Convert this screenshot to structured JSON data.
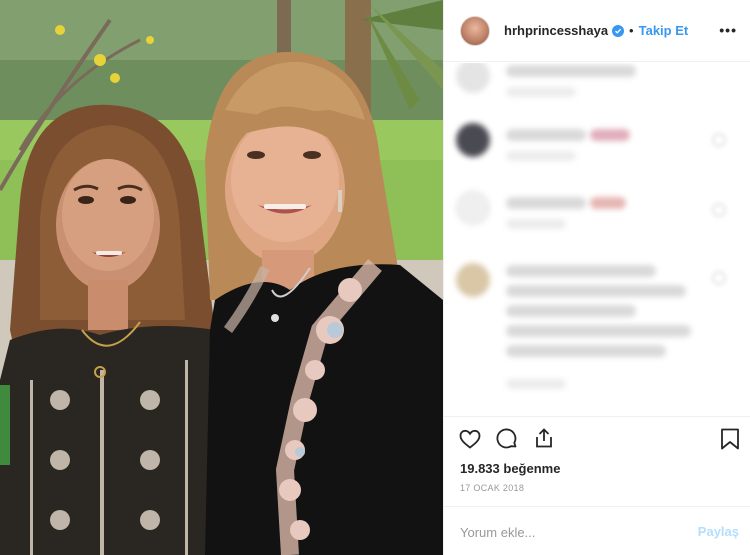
{
  "post": {
    "username": "hrhprincesshaya",
    "follow_label": "Takip Et",
    "separator": "•",
    "more_label": "•••",
    "likes_text": "19.833 beğenme",
    "date_text": "17 OCAK 2018"
  },
  "comment_box": {
    "placeholder": "Yorum ekle...",
    "share_label": "Paylaş"
  },
  "colors": {
    "accent": "#3897f0",
    "share_disabled": "#b2dffc",
    "text": "#262626",
    "muted": "#999999"
  },
  "icons": [
    "verified-badge-icon",
    "heart-icon",
    "comment-icon",
    "share-icon",
    "bookmark-icon",
    "more-options-icon"
  ]
}
